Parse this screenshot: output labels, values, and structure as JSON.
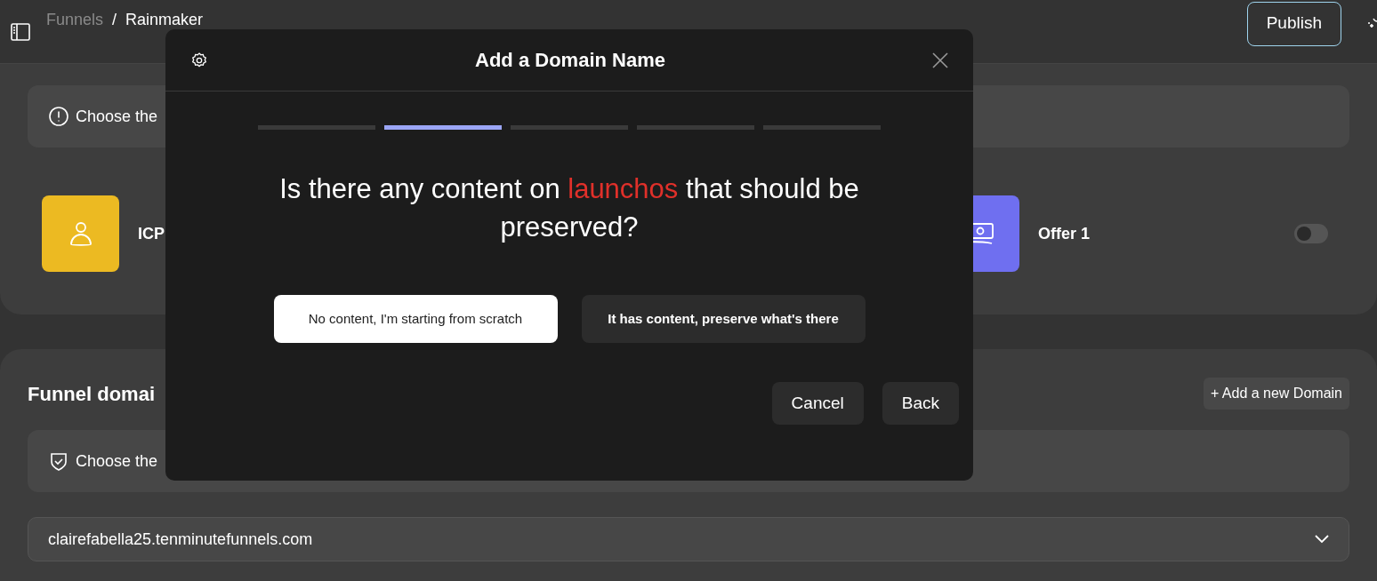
{
  "breadcrumb": {
    "parent": "Funnels",
    "separator": "/",
    "current": "Rainmaker"
  },
  "publish_button": "Publish",
  "notice": "Choose the",
  "cards": [
    {
      "kind": "person",
      "label": "ICP",
      "color": "#ecba22"
    },
    {
      "kind": "money",
      "label": "Offer 1",
      "color": "#6f6ff0",
      "toggle_on": false
    }
  ],
  "domains": {
    "title": "Funnel domai",
    "add_button": "+ Add a new Domain",
    "notice": "Choose the",
    "selected_domain": "clairefabella25.tenminutefunnels.com"
  },
  "modal": {
    "title": "Add a Domain Name",
    "steps": [
      {
        "selected": false
      },
      {
        "selected": true
      },
      {
        "selected": false
      },
      {
        "selected": false
      },
      {
        "selected": false
      }
    ],
    "question": {
      "before": "Is there any content on ",
      "highlight": "launchos",
      "after": " that should be preserved?"
    },
    "options": [
      {
        "label": "No content, I'm starting from scratch",
        "selected": true
      },
      {
        "label": "It has content, preserve what's there",
        "selected": false
      }
    ],
    "buttons": [
      "Cancel",
      "Back"
    ]
  }
}
